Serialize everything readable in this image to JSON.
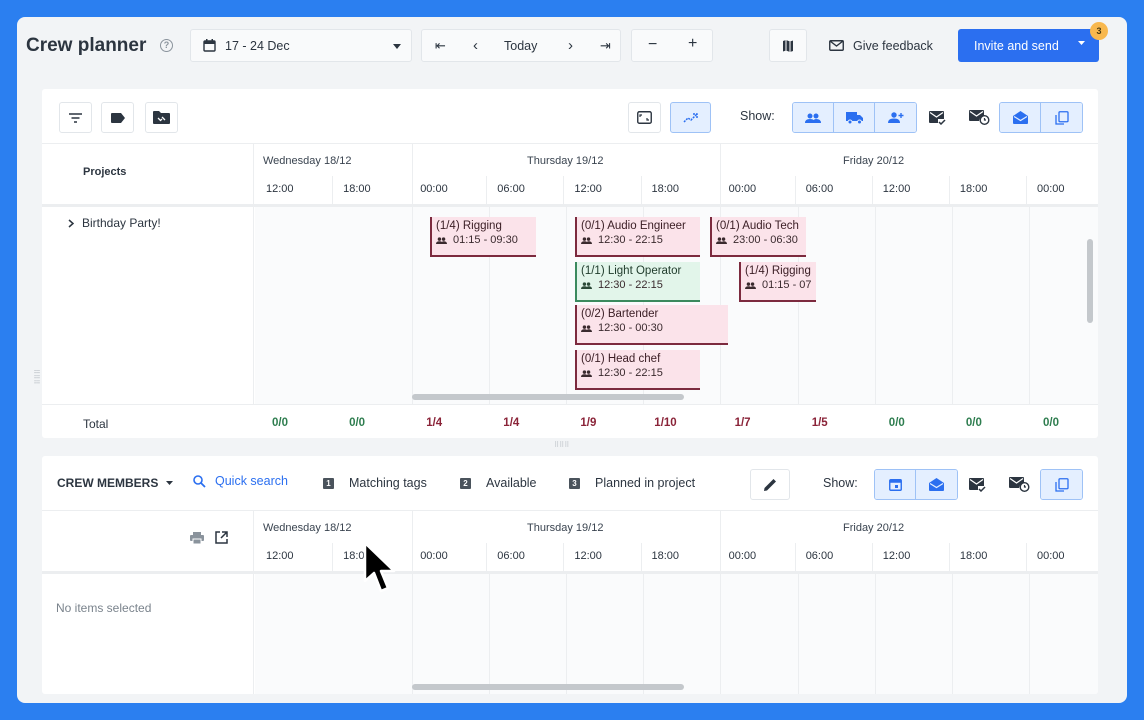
{
  "header": {
    "title": "Crew planner",
    "help_glyph": "?",
    "date_range": "17 - 24 Dec",
    "nav": {
      "first": "⇤",
      "prev": "‹",
      "today": "Today",
      "next": "›",
      "last": "⇥"
    },
    "zoom_out": "−",
    "zoom_in": "+",
    "feedback": "Give feedback",
    "invite": "Invite and send",
    "invite_badge": "3"
  },
  "timeline": {
    "days": [
      "Wednesday 18/12",
      "Thursday 19/12",
      "Friday 20/12"
    ],
    "hours": [
      "12:00",
      "18:00",
      "00:00",
      "06:00",
      "12:00",
      "18:00",
      "00:00",
      "06:00",
      "12:00",
      "18:00",
      "00:00"
    ]
  },
  "projects_panel": {
    "show_label": "Show:",
    "column_header": "Projects",
    "project_name": "Birthday Party!",
    "tasks": [
      {
        "title": "(1/4) Rigging",
        "time": "01:15 - 09:30",
        "status": "red"
      },
      {
        "title": "(0/1) Audio Engineer",
        "time": "12:30 - 22:15",
        "status": "red"
      },
      {
        "title": "(0/1) Audio Tech",
        "time": "23:00 - 06:30",
        "status": "red"
      },
      {
        "title": "(1/1) Light Operator",
        "time": "12:30 - 22:15",
        "status": "green"
      },
      {
        "title": "(1/4) Rigging",
        "time": "01:15 - 07",
        "status": "red"
      },
      {
        "title": "(0/2) Bartender",
        "time": "12:30 - 00:30",
        "status": "red"
      },
      {
        "title": "(0/1) Head chef",
        "time": "12:30 - 22:15",
        "status": "red"
      }
    ],
    "total_label": "Total",
    "totals": [
      "0/0",
      "0/0",
      "1/4",
      "1/4",
      "1/9",
      "1/10",
      "1/7",
      "1/5",
      "0/0",
      "0/0",
      "0/0"
    ]
  },
  "crew_panel": {
    "title": "CREW MEMBERS",
    "quick_search": "Quick search",
    "legend": [
      {
        "num": "1",
        "label": "Matching tags"
      },
      {
        "num": "2",
        "label": "Available"
      },
      {
        "num": "3",
        "label": "Planned in project"
      }
    ],
    "show_label": "Show:",
    "empty_text": "No items selected"
  },
  "colors": {
    "accent": "#2b6ff0",
    "background": "#2b7ff0",
    "task_red": "#fbe3ea",
    "task_green": "#e2f5ea",
    "badge": "#f8b84e"
  }
}
